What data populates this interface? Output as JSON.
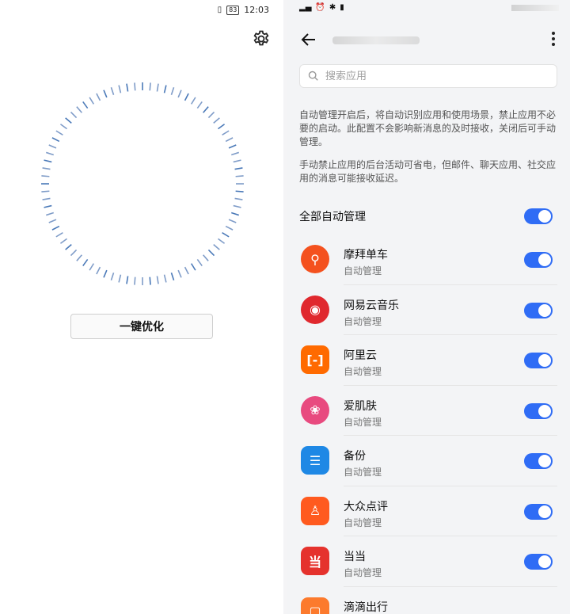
{
  "left": {
    "status": {
      "battery": "83",
      "time": "12:03"
    },
    "optimize_button": "一键优化"
  },
  "right": {
    "search": {
      "placeholder": "搜索应用"
    },
    "desc1": "自动管理开启后，将自动识别应用和使用场景，禁止应用不必要的启动。此配置不会影响新消息的及时接收，关闭后可手动管理。",
    "desc2": "手动禁止应用的后台活动可省电，但邮件、聊天应用、社交应用的消息可能接收延迟。",
    "all_auto": {
      "label": "全部自动管理",
      "on": true
    },
    "apps": [
      {
        "name": "摩拜单车",
        "status": "自动管理",
        "icon": "bike-icon",
        "color": "#f4511e",
        "on": true
      },
      {
        "name": "网易云音乐",
        "status": "自动管理",
        "icon": "music-icon",
        "color": "#e0282e",
        "on": true
      },
      {
        "name": "阿里云",
        "status": "自动管理",
        "icon": "aliyun-icon",
        "color": "#ff6a00",
        "on": true
      },
      {
        "name": "爱肌肤",
        "status": "自动管理",
        "icon": "lotus-icon",
        "color": "#e84a7f",
        "on": true
      },
      {
        "name": "备份",
        "status": "自动管理",
        "icon": "backup-icon",
        "color": "#1e88e5",
        "on": true
      },
      {
        "name": "大众点评",
        "status": "自动管理",
        "icon": "person-icon",
        "color": "#ff5a1f",
        "on": true
      },
      {
        "name": "当当",
        "status": "自动管理",
        "icon": "dangdang-icon",
        "color": "#e5322d",
        "on": true
      },
      {
        "name": "滴滴出行",
        "status": "",
        "icon": "didi-icon",
        "color": "#fc7a2d",
        "on": false
      }
    ]
  }
}
